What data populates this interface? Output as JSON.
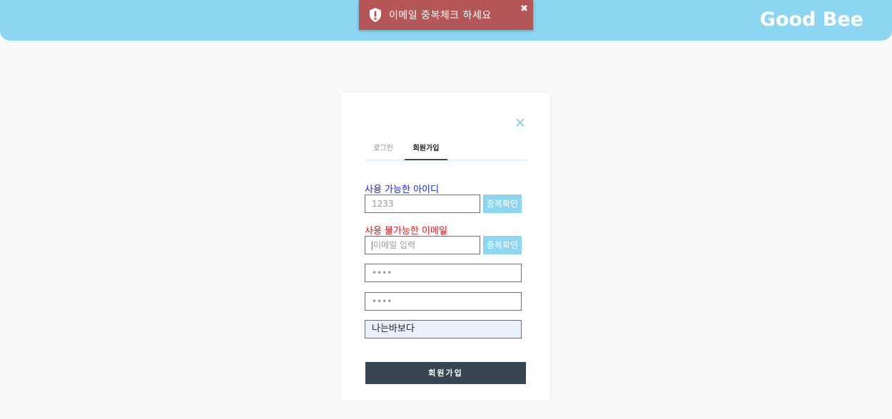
{
  "header": {
    "brand": "Good Bee",
    "background_color": "#8dd6f2"
  },
  "toast": {
    "icon": "shield-exclamation-icon",
    "message": "이메일 중복체크 하세요",
    "close_label": "✖",
    "background_color": "#b35655"
  },
  "modal": {
    "close_icon": "close-icon",
    "tabs": [
      {
        "label": "로그인",
        "active": false
      },
      {
        "label": "회원가입",
        "active": true
      }
    ],
    "id_status": "사용 가능한 아이디",
    "id_value": "1233",
    "id_check_label": "중복확인",
    "email_status": "사용 불가능한 이메일",
    "email_placeholder": "이메일 입력",
    "email_check_label": "중복확인",
    "password_mask": "••••",
    "password_confirm_mask": "••••",
    "nickname_value": "나는바보다",
    "submit_label": "회원가입",
    "valid_color": "#1c25d6",
    "invalid_color": "#e01616",
    "accent_color": "#8dd6f2",
    "submit_color": "#364550"
  }
}
